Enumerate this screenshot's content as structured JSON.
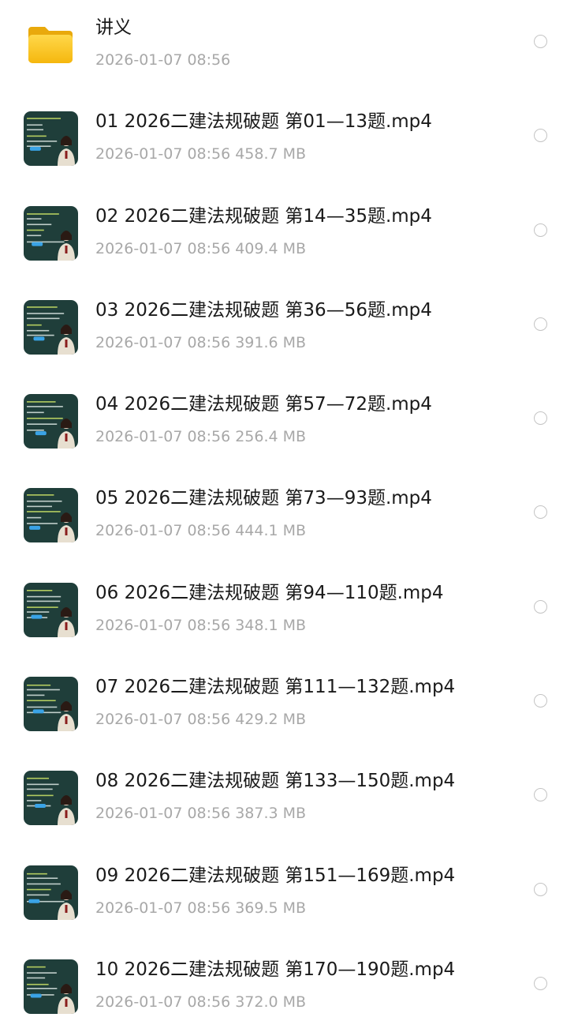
{
  "files": [
    {
      "type": "folder",
      "icon": "folder-icon",
      "name": "讲义",
      "date": "2026-01-07 08:56",
      "size": ""
    },
    {
      "type": "video",
      "icon": "video-thumbnail",
      "name": "01 2026二建法规破题 第01—13题.mp4",
      "date": "2026-01-07 08:56",
      "size": "458.7 MB"
    },
    {
      "type": "video",
      "icon": "video-thumbnail",
      "name": "02 2026二建法规破题 第14—35题.mp4",
      "date": "2026-01-07 08:56",
      "size": "409.4 MB"
    },
    {
      "type": "video",
      "icon": "video-thumbnail",
      "name": "03 2026二建法规破题 第36—56题.mp4",
      "date": "2026-01-07 08:56",
      "size": "391.6 MB"
    },
    {
      "type": "video",
      "icon": "video-thumbnail",
      "name": "04 2026二建法规破题 第57—72题.mp4",
      "date": "2026-01-07 08:56",
      "size": "256.4 MB"
    },
    {
      "type": "video",
      "icon": "video-thumbnail",
      "name": "05 2026二建法规破题 第73—93题.mp4",
      "date": "2026-01-07 08:56",
      "size": "444.1 MB"
    },
    {
      "type": "video",
      "icon": "video-thumbnail",
      "name": "06 2026二建法规破题 第94—110题.mp4",
      "date": "2026-01-07 08:56",
      "size": "348.1 MB"
    },
    {
      "type": "video",
      "icon": "video-thumbnail",
      "name": "07 2026二建法规破题 第111—132题.mp4",
      "date": "2026-01-07 08:56",
      "size": "429.2 MB"
    },
    {
      "type": "video",
      "icon": "video-thumbnail",
      "name": "08 2026二建法规破题 第133—150题.mp4",
      "date": "2026-01-07 08:56",
      "size": "387.3 MB"
    },
    {
      "type": "video",
      "icon": "video-thumbnail",
      "name": "09 2026二建法规破题 第151—169题.mp4",
      "date": "2026-01-07 08:56",
      "size": "369.5 MB"
    },
    {
      "type": "video",
      "icon": "video-thumbnail",
      "name": "10 2026二建法规破题 第170—190题.mp4",
      "date": "2026-01-07 08:56",
      "size": "372.0 MB"
    }
  ],
  "colors": {
    "title_text": "#1a1a1a",
    "meta_text": "#a8a8a8",
    "folder_yellow": "#f7c21c",
    "thumbnail_board": "#1f3e3a",
    "radio_border": "#c4c4c4"
  }
}
